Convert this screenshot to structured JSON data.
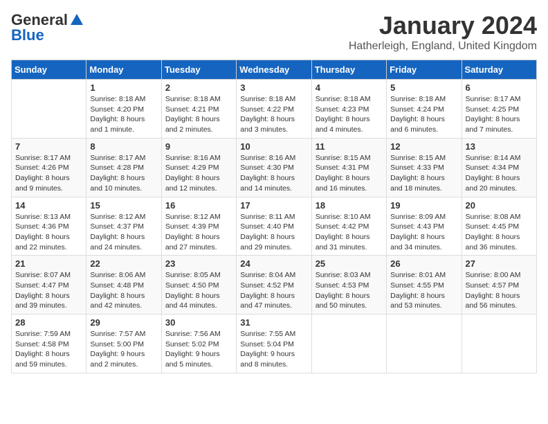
{
  "header": {
    "logo_general": "General",
    "logo_blue": "Blue",
    "month_title": "January 2024",
    "location": "Hatherleigh, England, United Kingdom"
  },
  "weekdays": [
    "Sunday",
    "Monday",
    "Tuesday",
    "Wednesday",
    "Thursday",
    "Friday",
    "Saturday"
  ],
  "weeks": [
    [
      {
        "day": "",
        "sunrise": "",
        "sunset": "",
        "daylight": ""
      },
      {
        "day": "1",
        "sunrise": "Sunrise: 8:18 AM",
        "sunset": "Sunset: 4:20 PM",
        "daylight": "Daylight: 8 hours and 1 minute."
      },
      {
        "day": "2",
        "sunrise": "Sunrise: 8:18 AM",
        "sunset": "Sunset: 4:21 PM",
        "daylight": "Daylight: 8 hours and 2 minutes."
      },
      {
        "day": "3",
        "sunrise": "Sunrise: 8:18 AM",
        "sunset": "Sunset: 4:22 PM",
        "daylight": "Daylight: 8 hours and 3 minutes."
      },
      {
        "day": "4",
        "sunrise": "Sunrise: 8:18 AM",
        "sunset": "Sunset: 4:23 PM",
        "daylight": "Daylight: 8 hours and 4 minutes."
      },
      {
        "day": "5",
        "sunrise": "Sunrise: 8:18 AM",
        "sunset": "Sunset: 4:24 PM",
        "daylight": "Daylight: 8 hours and 6 minutes."
      },
      {
        "day": "6",
        "sunrise": "Sunrise: 8:17 AM",
        "sunset": "Sunset: 4:25 PM",
        "daylight": "Daylight: 8 hours and 7 minutes."
      }
    ],
    [
      {
        "day": "7",
        "sunrise": "Sunrise: 8:17 AM",
        "sunset": "Sunset: 4:26 PM",
        "daylight": "Daylight: 8 hours and 9 minutes."
      },
      {
        "day": "8",
        "sunrise": "Sunrise: 8:17 AM",
        "sunset": "Sunset: 4:28 PM",
        "daylight": "Daylight: 8 hours and 10 minutes."
      },
      {
        "day": "9",
        "sunrise": "Sunrise: 8:16 AM",
        "sunset": "Sunset: 4:29 PM",
        "daylight": "Daylight: 8 hours and 12 minutes."
      },
      {
        "day": "10",
        "sunrise": "Sunrise: 8:16 AM",
        "sunset": "Sunset: 4:30 PM",
        "daylight": "Daylight: 8 hours and 14 minutes."
      },
      {
        "day": "11",
        "sunrise": "Sunrise: 8:15 AM",
        "sunset": "Sunset: 4:31 PM",
        "daylight": "Daylight: 8 hours and 16 minutes."
      },
      {
        "day": "12",
        "sunrise": "Sunrise: 8:15 AM",
        "sunset": "Sunset: 4:33 PM",
        "daylight": "Daylight: 8 hours and 18 minutes."
      },
      {
        "day": "13",
        "sunrise": "Sunrise: 8:14 AM",
        "sunset": "Sunset: 4:34 PM",
        "daylight": "Daylight: 8 hours and 20 minutes."
      }
    ],
    [
      {
        "day": "14",
        "sunrise": "Sunrise: 8:13 AM",
        "sunset": "Sunset: 4:36 PM",
        "daylight": "Daylight: 8 hours and 22 minutes."
      },
      {
        "day": "15",
        "sunrise": "Sunrise: 8:12 AM",
        "sunset": "Sunset: 4:37 PM",
        "daylight": "Daylight: 8 hours and 24 minutes."
      },
      {
        "day": "16",
        "sunrise": "Sunrise: 8:12 AM",
        "sunset": "Sunset: 4:39 PM",
        "daylight": "Daylight: 8 hours and 27 minutes."
      },
      {
        "day": "17",
        "sunrise": "Sunrise: 8:11 AM",
        "sunset": "Sunset: 4:40 PM",
        "daylight": "Daylight: 8 hours and 29 minutes."
      },
      {
        "day": "18",
        "sunrise": "Sunrise: 8:10 AM",
        "sunset": "Sunset: 4:42 PM",
        "daylight": "Daylight: 8 hours and 31 minutes."
      },
      {
        "day": "19",
        "sunrise": "Sunrise: 8:09 AM",
        "sunset": "Sunset: 4:43 PM",
        "daylight": "Daylight: 8 hours and 34 minutes."
      },
      {
        "day": "20",
        "sunrise": "Sunrise: 8:08 AM",
        "sunset": "Sunset: 4:45 PM",
        "daylight": "Daylight: 8 hours and 36 minutes."
      }
    ],
    [
      {
        "day": "21",
        "sunrise": "Sunrise: 8:07 AM",
        "sunset": "Sunset: 4:47 PM",
        "daylight": "Daylight: 8 hours and 39 minutes."
      },
      {
        "day": "22",
        "sunrise": "Sunrise: 8:06 AM",
        "sunset": "Sunset: 4:48 PM",
        "daylight": "Daylight: 8 hours and 42 minutes."
      },
      {
        "day": "23",
        "sunrise": "Sunrise: 8:05 AM",
        "sunset": "Sunset: 4:50 PM",
        "daylight": "Daylight: 8 hours and 44 minutes."
      },
      {
        "day": "24",
        "sunrise": "Sunrise: 8:04 AM",
        "sunset": "Sunset: 4:52 PM",
        "daylight": "Daylight: 8 hours and 47 minutes."
      },
      {
        "day": "25",
        "sunrise": "Sunrise: 8:03 AM",
        "sunset": "Sunset: 4:53 PM",
        "daylight": "Daylight: 8 hours and 50 minutes."
      },
      {
        "day": "26",
        "sunrise": "Sunrise: 8:01 AM",
        "sunset": "Sunset: 4:55 PM",
        "daylight": "Daylight: 8 hours and 53 minutes."
      },
      {
        "day": "27",
        "sunrise": "Sunrise: 8:00 AM",
        "sunset": "Sunset: 4:57 PM",
        "daylight": "Daylight: 8 hours and 56 minutes."
      }
    ],
    [
      {
        "day": "28",
        "sunrise": "Sunrise: 7:59 AM",
        "sunset": "Sunset: 4:58 PM",
        "daylight": "Daylight: 8 hours and 59 minutes."
      },
      {
        "day": "29",
        "sunrise": "Sunrise: 7:57 AM",
        "sunset": "Sunset: 5:00 PM",
        "daylight": "Daylight: 9 hours and 2 minutes."
      },
      {
        "day": "30",
        "sunrise": "Sunrise: 7:56 AM",
        "sunset": "Sunset: 5:02 PM",
        "daylight": "Daylight: 9 hours and 5 minutes."
      },
      {
        "day": "31",
        "sunrise": "Sunrise: 7:55 AM",
        "sunset": "Sunset: 5:04 PM",
        "daylight": "Daylight: 9 hours and 8 minutes."
      },
      {
        "day": "",
        "sunrise": "",
        "sunset": "",
        "daylight": ""
      },
      {
        "day": "",
        "sunrise": "",
        "sunset": "",
        "daylight": ""
      },
      {
        "day": "",
        "sunrise": "",
        "sunset": "",
        "daylight": ""
      }
    ]
  ]
}
